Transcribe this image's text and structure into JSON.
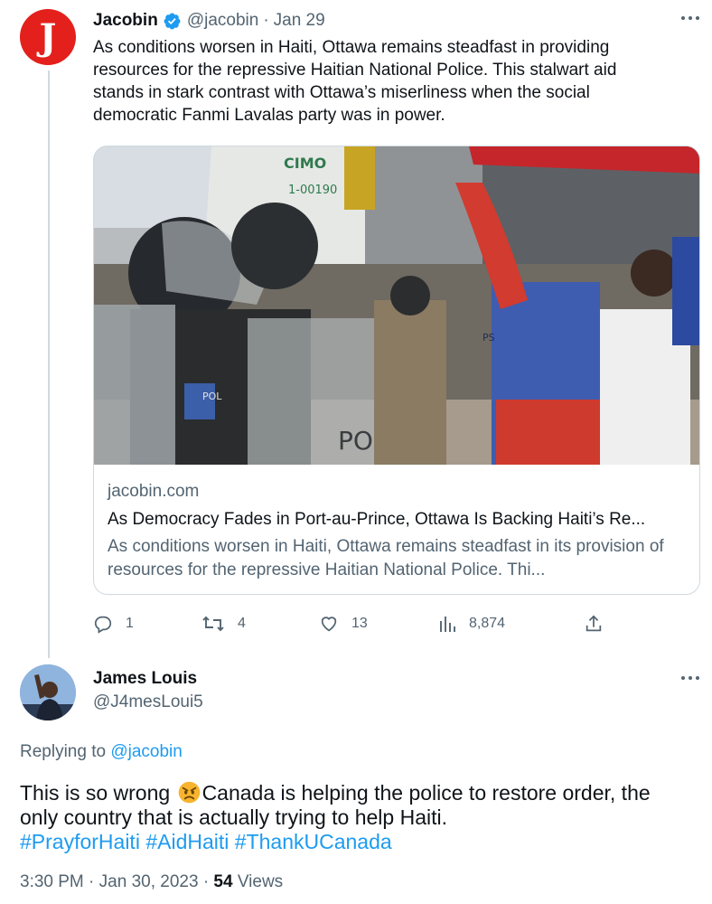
{
  "tweet": {
    "author": {
      "name": "Jacobin",
      "handle": "@jacobin",
      "avatar_letter": "J",
      "verified": true
    },
    "date": "Jan 29",
    "dot": "·",
    "text": "As conditions worsen in Haiti, Ottawa remains steadfast in providing resources for the repressive Haitian National Police. This stalwart aid stands in stark contrast with Ottawa’s miserliness when the social democratic Fanmi Lavalas party was in power.",
    "card": {
      "domain": "jacobin.com",
      "title": "As Democracy Fades in Port-au-Prince, Ottawa Is Backing Haiti’s Re...",
      "description": "As conditions worsen in Haiti, Ottawa remains steadfast in its provision of resources for the repressive Haitian National Police. Thi...",
      "image_texts": {
        "sign_top": "CIMO",
        "sign_bottom": "1-00190",
        "patch": "POL",
        "shield": "PO",
        "vest": "PS"
      }
    },
    "actions": {
      "replies": "1",
      "retweets": "4",
      "likes": "13",
      "views": "8,874"
    }
  },
  "reply": {
    "author": {
      "name": "James Louis",
      "handle": "@J4mesLoui5"
    },
    "replying_label": "Replying to ",
    "replying_to": "@jacobin",
    "text_before_emoji": "This is so wrong ",
    "emoji": "angry-face",
    "text_after_emoji": "Canada is helping the police to restore order, the only country that is actually trying to help Haiti. ",
    "hashtags": [
      "#PrayforHaiti",
      "#AidHaiti",
      "#ThankUCanada"
    ],
    "time": "3:30 PM",
    "date": "Jan 30, 2023",
    "dot": "·",
    "views_count": "54",
    "views_label": " Views"
  },
  "colors": {
    "brand_red": "#e3201b",
    "link_blue": "#1d9bf0",
    "muted": "#536471",
    "border": "#cfd9de"
  }
}
